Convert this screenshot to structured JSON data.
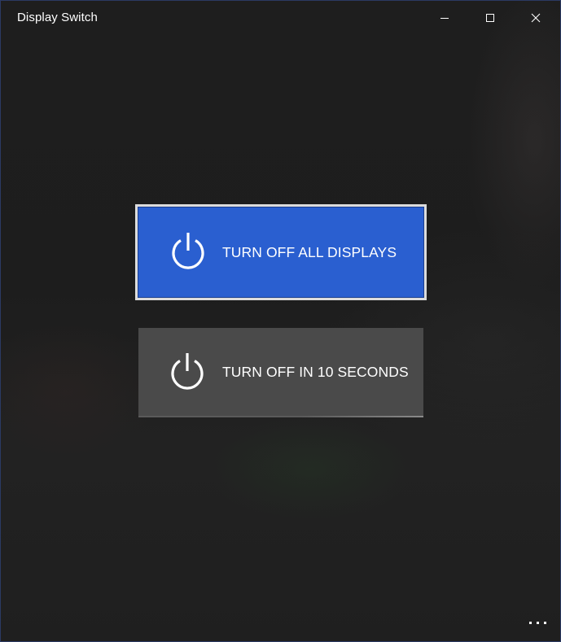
{
  "window": {
    "title": "Display Switch",
    "controls": {
      "minimize": "minimize-icon",
      "maximize": "maximize-icon",
      "close": "close-icon"
    }
  },
  "actions": {
    "turn_off_all": {
      "label": "TURN OFF ALL DISPLAYS",
      "icon": "power-icon",
      "background": "#2a5fd0",
      "focused": true
    },
    "turn_off_delay": {
      "label": "TURN OFF IN 10 SECONDS",
      "icon": "power-icon",
      "background": "#4a4a4a",
      "focused": false
    }
  },
  "more_menu": {
    "icon": "more-icon"
  }
}
